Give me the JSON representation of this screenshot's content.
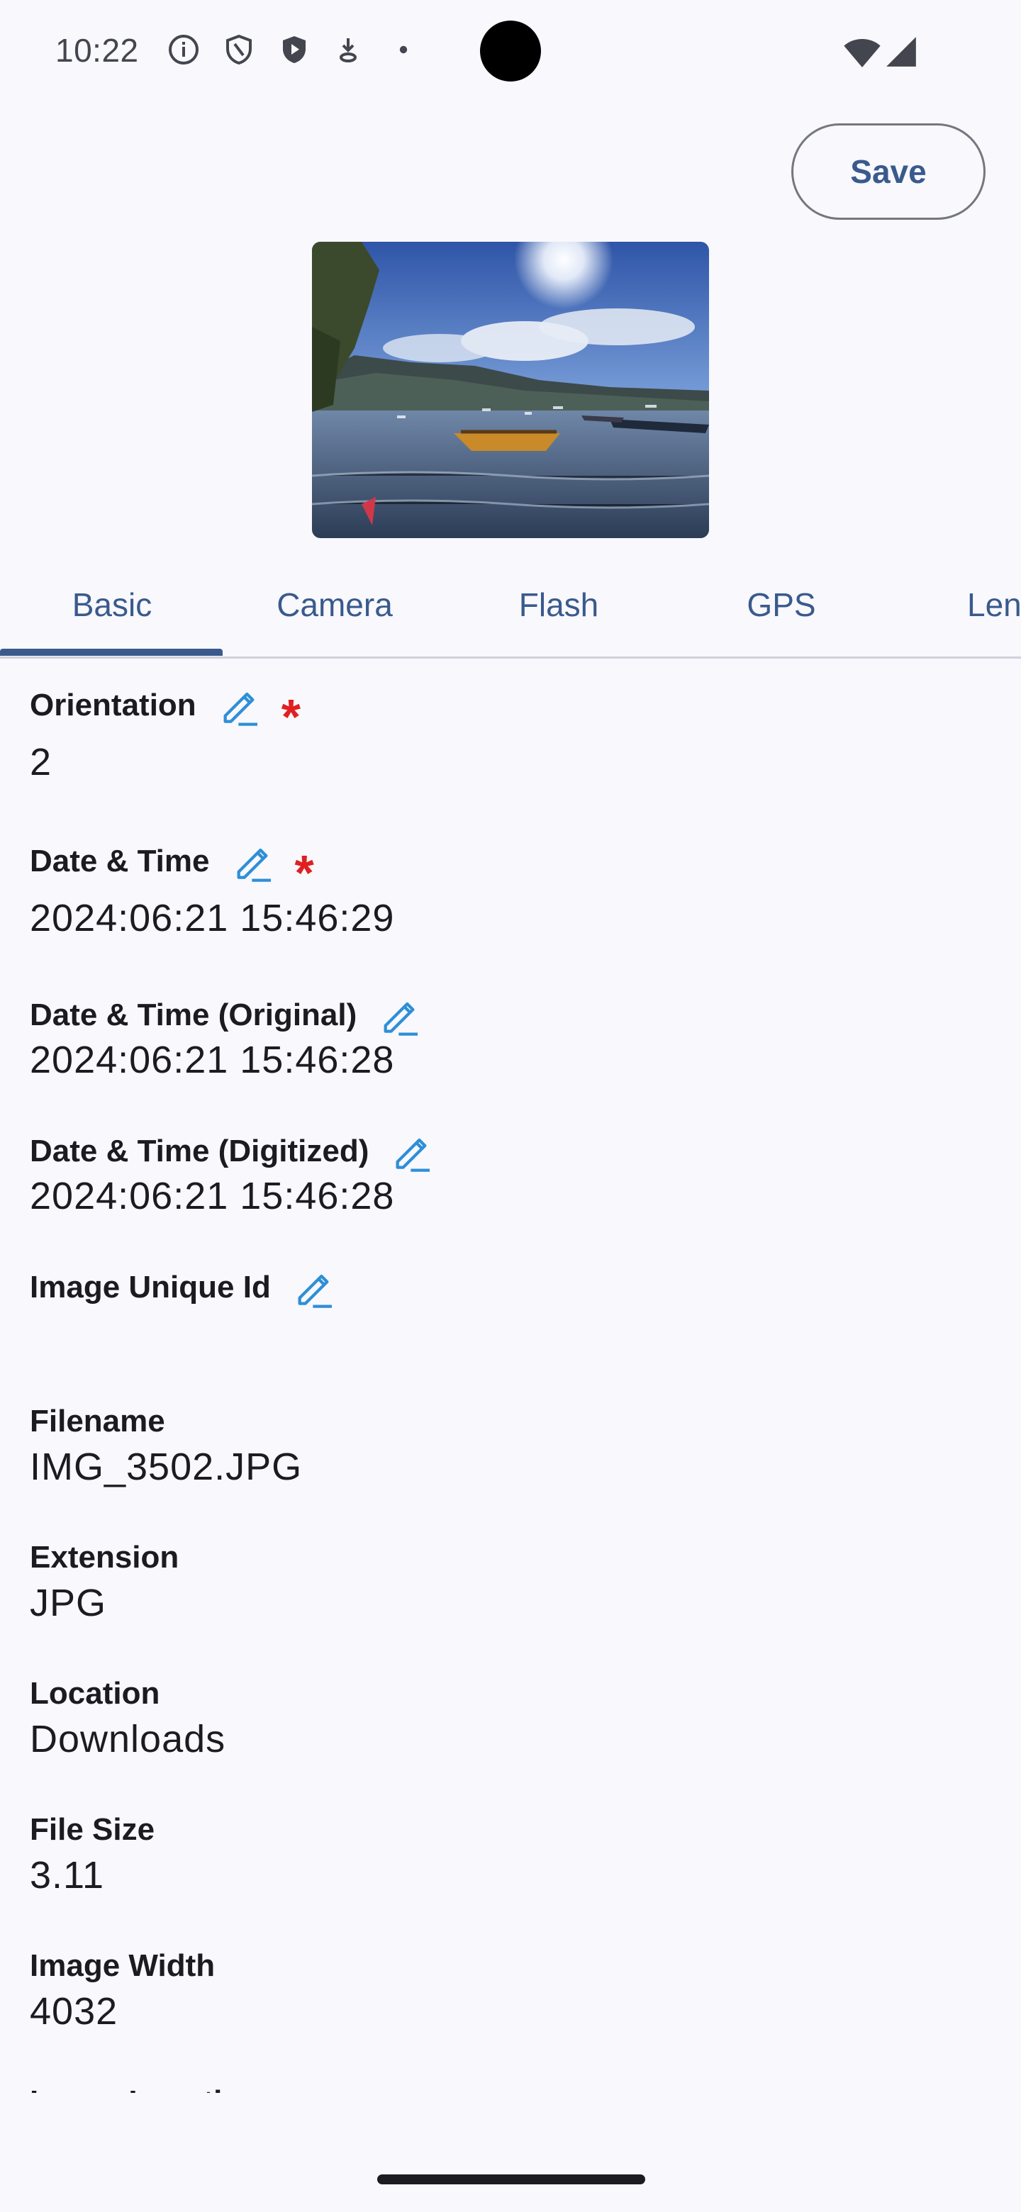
{
  "status_bar": {
    "time": "10:22",
    "icons": [
      "info-icon",
      "shield-outline-icon",
      "shield-play-icon",
      "download-icon",
      "dot-icon",
      "wifi-icon",
      "cellular-signal-icon"
    ]
  },
  "header": {
    "save_label": "Save"
  },
  "photo": {
    "subject": "lake-with-boats-icon"
  },
  "tabs": [
    {
      "label": "Basic",
      "selected": true
    },
    {
      "label": "Camera",
      "selected": false
    },
    {
      "label": "Flash",
      "selected": false
    },
    {
      "label": "GPS",
      "selected": false
    },
    {
      "label": "Len",
      "selected": false
    }
  ],
  "fields": {
    "orientation": {
      "label": "Orientation",
      "value": "2",
      "editable": true,
      "required": true
    },
    "date_time": {
      "label": "Date & Time",
      "value": "2024:06:21 15:46:29",
      "editable": true,
      "required": true
    },
    "date_time_original": {
      "label": "Date & Time (Original)",
      "value": "2024:06:21 15:46:28",
      "editable": true,
      "required": false
    },
    "date_time_digitized": {
      "label": "Date & Time (Digitized)",
      "value": "2024:06:21 15:46:28",
      "editable": true,
      "required": false
    },
    "image_unique_id": {
      "label": "Image Unique Id",
      "value": "",
      "editable": true,
      "required": false
    },
    "filename": {
      "label": "Filename",
      "value": "IMG_3502.JPG"
    },
    "extension": {
      "label": "Extension",
      "value": "JPG"
    },
    "location": {
      "label": "Location",
      "value": "Downloads"
    },
    "file_size": {
      "label": "File Size",
      "value": "3.11"
    },
    "image_width": {
      "label": "Image Width",
      "value": "4032"
    },
    "image_length_partial": {
      "label": "Image Length"
    }
  },
  "colors": {
    "accent": "#3a5a8c",
    "edit_icon": "#2e8fd6",
    "required": "#e02020",
    "background": "#f8f8fd"
  }
}
